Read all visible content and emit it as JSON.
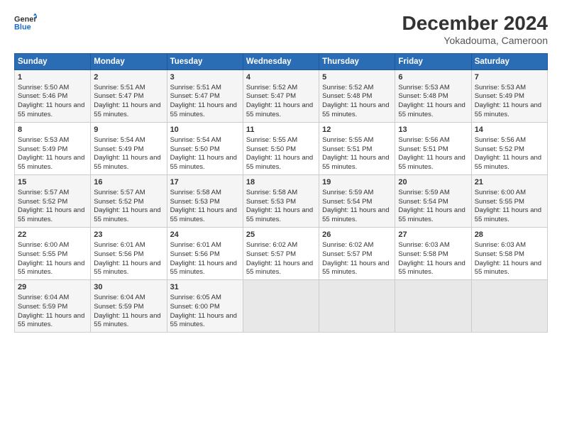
{
  "logo": {
    "line1": "General",
    "line2": "Blue"
  },
  "title": "December 2024",
  "subtitle": "Yokadouma, Cameroon",
  "days_of_week": [
    "Sunday",
    "Monday",
    "Tuesday",
    "Wednesday",
    "Thursday",
    "Friday",
    "Saturday"
  ],
  "weeks": [
    [
      {
        "day": 1,
        "sunrise": "5:50 AM",
        "sunset": "5:46 PM",
        "daylight": "11 hours and 55 minutes."
      },
      {
        "day": 2,
        "sunrise": "5:51 AM",
        "sunset": "5:47 PM",
        "daylight": "11 hours and 55 minutes."
      },
      {
        "day": 3,
        "sunrise": "5:51 AM",
        "sunset": "5:47 PM",
        "daylight": "11 hours and 55 minutes."
      },
      {
        "day": 4,
        "sunrise": "5:52 AM",
        "sunset": "5:47 PM",
        "daylight": "11 hours and 55 minutes."
      },
      {
        "day": 5,
        "sunrise": "5:52 AM",
        "sunset": "5:48 PM",
        "daylight": "11 hours and 55 minutes."
      },
      {
        "day": 6,
        "sunrise": "5:53 AM",
        "sunset": "5:48 PM",
        "daylight": "11 hours and 55 minutes."
      },
      {
        "day": 7,
        "sunrise": "5:53 AM",
        "sunset": "5:49 PM",
        "daylight": "11 hours and 55 minutes."
      }
    ],
    [
      {
        "day": 8,
        "sunrise": "5:53 AM",
        "sunset": "5:49 PM",
        "daylight": "11 hours and 55 minutes."
      },
      {
        "day": 9,
        "sunrise": "5:54 AM",
        "sunset": "5:49 PM",
        "daylight": "11 hours and 55 minutes."
      },
      {
        "day": 10,
        "sunrise": "5:54 AM",
        "sunset": "5:50 PM",
        "daylight": "11 hours and 55 minutes."
      },
      {
        "day": 11,
        "sunrise": "5:55 AM",
        "sunset": "5:50 PM",
        "daylight": "11 hours and 55 minutes."
      },
      {
        "day": 12,
        "sunrise": "5:55 AM",
        "sunset": "5:51 PM",
        "daylight": "11 hours and 55 minutes."
      },
      {
        "day": 13,
        "sunrise": "5:56 AM",
        "sunset": "5:51 PM",
        "daylight": "11 hours and 55 minutes."
      },
      {
        "day": 14,
        "sunrise": "5:56 AM",
        "sunset": "5:52 PM",
        "daylight": "11 hours and 55 minutes."
      }
    ],
    [
      {
        "day": 15,
        "sunrise": "5:57 AM",
        "sunset": "5:52 PM",
        "daylight": "11 hours and 55 minutes."
      },
      {
        "day": 16,
        "sunrise": "5:57 AM",
        "sunset": "5:52 PM",
        "daylight": "11 hours and 55 minutes."
      },
      {
        "day": 17,
        "sunrise": "5:58 AM",
        "sunset": "5:53 PM",
        "daylight": "11 hours and 55 minutes."
      },
      {
        "day": 18,
        "sunrise": "5:58 AM",
        "sunset": "5:53 PM",
        "daylight": "11 hours and 55 minutes."
      },
      {
        "day": 19,
        "sunrise": "5:59 AM",
        "sunset": "5:54 PM",
        "daylight": "11 hours and 55 minutes."
      },
      {
        "day": 20,
        "sunrise": "5:59 AM",
        "sunset": "5:54 PM",
        "daylight": "11 hours and 55 minutes."
      },
      {
        "day": 21,
        "sunrise": "6:00 AM",
        "sunset": "5:55 PM",
        "daylight": "11 hours and 55 minutes."
      }
    ],
    [
      {
        "day": 22,
        "sunrise": "6:00 AM",
        "sunset": "5:55 PM",
        "daylight": "11 hours and 55 minutes."
      },
      {
        "day": 23,
        "sunrise": "6:01 AM",
        "sunset": "5:56 PM",
        "daylight": "11 hours and 55 minutes."
      },
      {
        "day": 24,
        "sunrise": "6:01 AM",
        "sunset": "5:56 PM",
        "daylight": "11 hours and 55 minutes."
      },
      {
        "day": 25,
        "sunrise": "6:02 AM",
        "sunset": "5:57 PM",
        "daylight": "11 hours and 55 minutes."
      },
      {
        "day": 26,
        "sunrise": "6:02 AM",
        "sunset": "5:57 PM",
        "daylight": "11 hours and 55 minutes."
      },
      {
        "day": 27,
        "sunrise": "6:03 AM",
        "sunset": "5:58 PM",
        "daylight": "11 hours and 55 minutes."
      },
      {
        "day": 28,
        "sunrise": "6:03 AM",
        "sunset": "5:58 PM",
        "daylight": "11 hours and 55 minutes."
      }
    ],
    [
      {
        "day": 29,
        "sunrise": "6:04 AM",
        "sunset": "5:59 PM",
        "daylight": "11 hours and 55 minutes."
      },
      {
        "day": 30,
        "sunrise": "6:04 AM",
        "sunset": "5:59 PM",
        "daylight": "11 hours and 55 minutes."
      },
      {
        "day": 31,
        "sunrise": "6:05 AM",
        "sunset": "6:00 PM",
        "daylight": "11 hours and 55 minutes."
      },
      null,
      null,
      null,
      null
    ]
  ],
  "labels": {
    "sunrise": "Sunrise:",
    "sunset": "Sunset:",
    "daylight": "Daylight:"
  }
}
